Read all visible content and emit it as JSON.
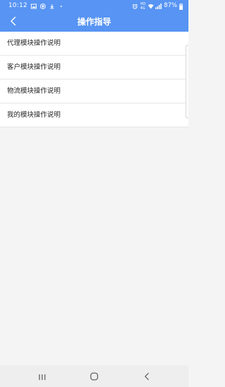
{
  "status_bar": {
    "time": "10:12",
    "small_label_top": "HD",
    "small_label_bottom": "4G",
    "battery_text": "87%"
  },
  "nav": {
    "title": "操作指导"
  },
  "list": [
    {
      "label": "代理模块操作说明"
    },
    {
      "label": "客户模块操作说明"
    },
    {
      "label": "物流模块操作说明"
    },
    {
      "label": "我的模块操作说明"
    }
  ],
  "colors": {
    "header": "#5794f3",
    "background": "#f4f4f4",
    "text": "#262626"
  },
  "icons": {
    "back": "chevron-left-icon",
    "recents": "recent-apps-icon",
    "home": "home-icon",
    "system_back": "system-back-icon"
  }
}
